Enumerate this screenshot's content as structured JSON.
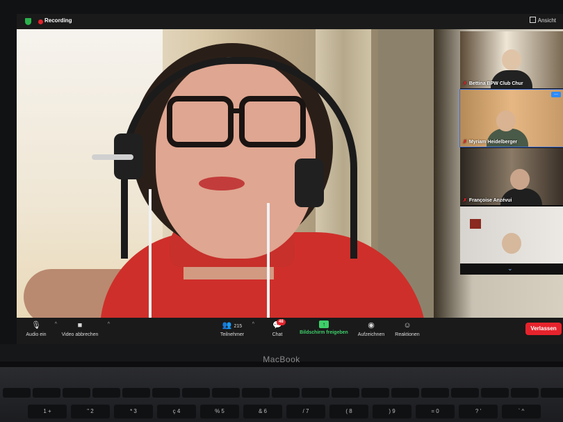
{
  "topbar": {
    "recording_label": "Recording",
    "view_label": "Ansicht",
    "colors": {
      "recording": "#e5232c",
      "security": "#2bb24c"
    }
  },
  "gallery": {
    "participants": [
      {
        "name": "Bettina BPW Club Chur",
        "muted": true
      },
      {
        "name": "Myriam Heidelberger",
        "muted": true,
        "more_label": "..."
      },
      {
        "name": "Françoise Anzévui",
        "muted": true
      },
      {
        "name": "",
        "muted": false
      }
    ],
    "scroll_icon": "chevron-down-icon",
    "scroll_glyph": "⌄"
  },
  "toolbar": {
    "audio_label": "Audio ein",
    "video_label": "Video abbrechen",
    "participants_label": "Teilnehmer",
    "participants_count": "215",
    "chat_label": "Chat",
    "chat_badge": "48",
    "share_label": "Bildschirm freigeben",
    "record_label": "Aufzeichnen",
    "reactions_label": "Reaktionen",
    "leave_label": "Verlassen",
    "colors": {
      "share": "#3ecf6a",
      "leave": "#e5232c",
      "badge": "#e5232c"
    }
  },
  "laptop": {
    "brand": "MacBook",
    "keys_row1": [
      "",
      "",
      "",
      "",
      "",
      "",
      "",
      "",
      "",
      "",
      "",
      "",
      "",
      "",
      "",
      "",
      "",
      "",
      ""
    ],
    "keys_row2": [
      "1",
      "\"",
      "*",
      "ç",
      "%",
      "&",
      "/",
      "(",
      ")",
      "=",
      "?",
      "`"
    ],
    "keys_row2_top": [
      "+",
      "2",
      "3",
      "4",
      "5",
      "6",
      "7",
      "8",
      "9",
      "0",
      "'",
      "^"
    ]
  }
}
